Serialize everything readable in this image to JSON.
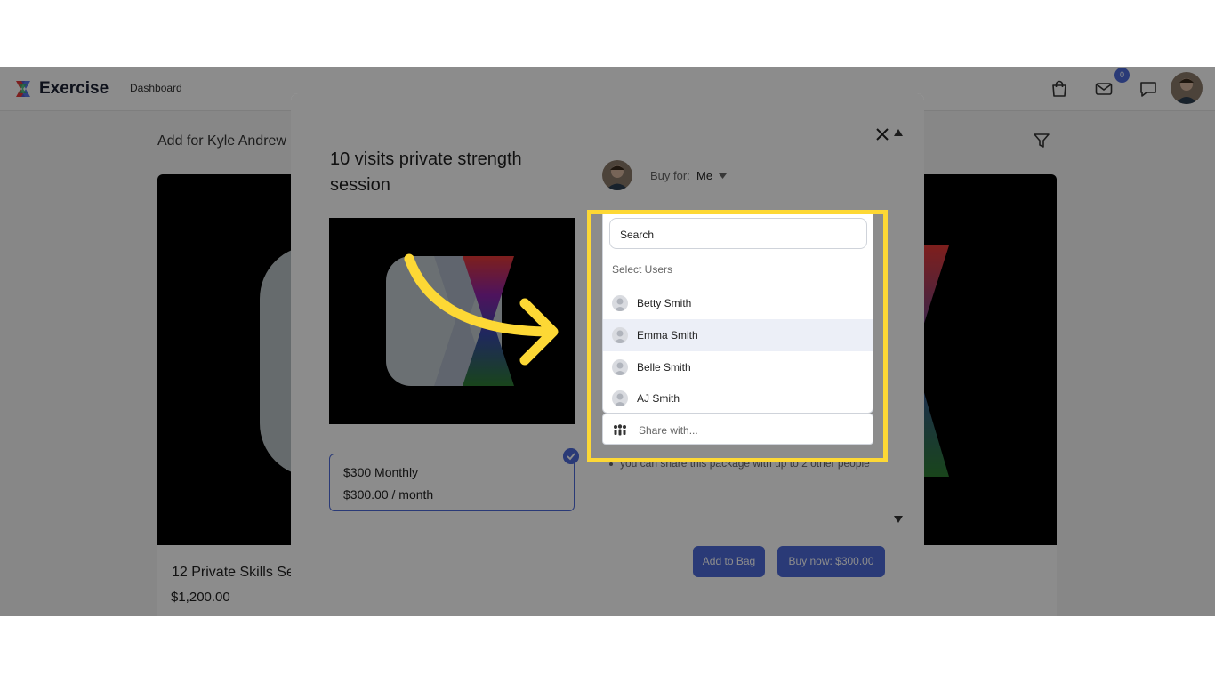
{
  "app": {
    "brand": "Exercise",
    "nav": {
      "dashboard": "Dashboard"
    },
    "notification_count": "0"
  },
  "page": {
    "heading": "Add for Kyle Andrew",
    "card": {
      "title": "12 Private Skills Se",
      "price": "$1,200.00"
    }
  },
  "modal": {
    "title": "10 visits private strength session",
    "buy_for": {
      "label": "Buy for:",
      "value": "Me"
    },
    "price_option": {
      "line1": "$300 Monthly",
      "line2": "$300.00 / month",
      "selected": true
    },
    "share_note": "you can share this package with up to 2 other people",
    "add_to_bag": "Add to Bag",
    "buy_now": "Buy now: $300.00"
  },
  "dropdown": {
    "search_value": "Search",
    "section_label": "Select Users",
    "users": [
      {
        "name": "Betty Smith",
        "highlighted": false
      },
      {
        "name": "Emma Smith",
        "highlighted": true
      },
      {
        "name": "Belle Smith",
        "highlighted": false
      },
      {
        "name": "AJ Smith",
        "highlighted": false
      }
    ],
    "share_placeholder": "Share with..."
  },
  "colors": {
    "accent": "#4e6bd9",
    "highlight_frame": "#fdd835",
    "annotation_arrow": "#fdd835"
  },
  "icons": [
    "close-icon",
    "shopping-bag-icon",
    "mail-icon",
    "chat-icon",
    "filter-icon",
    "chevron-down-icon",
    "people-icon",
    "check-icon"
  ]
}
